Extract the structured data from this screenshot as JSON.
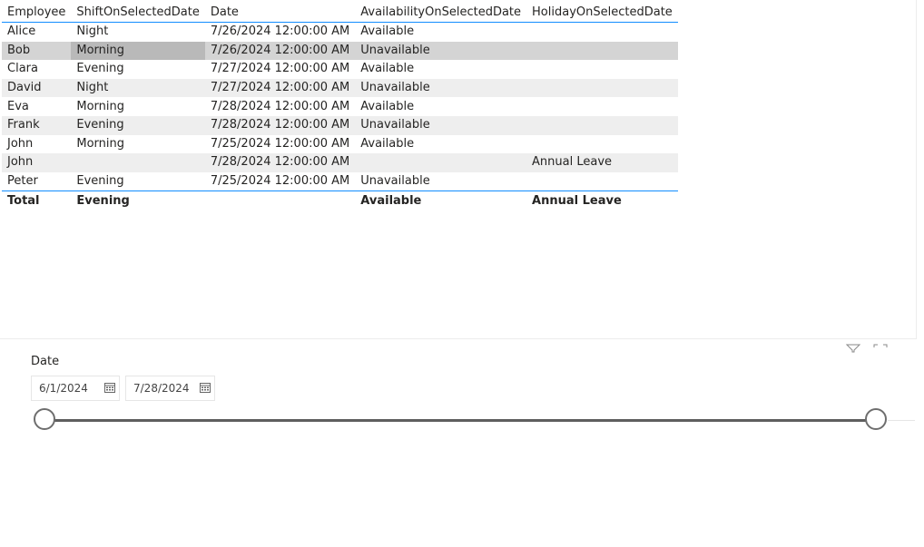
{
  "table": {
    "headers": [
      "Employee",
      "ShiftOnSelectedDate",
      "Date",
      "AvailabilityOnSelectedDate",
      "HolidayOnSelectedDate"
    ],
    "rows": [
      [
        "Alice",
        "Night",
        "7/26/2024 12:00:00 AM",
        "Available",
        ""
      ],
      [
        "Bob",
        "Morning",
        "7/26/2024 12:00:00 AM",
        "Unavailable",
        ""
      ],
      [
        "Clara",
        "Evening",
        "7/27/2024 12:00:00 AM",
        "Available",
        ""
      ],
      [
        "David",
        "Night",
        "7/27/2024 12:00:00 AM",
        "Unavailable",
        ""
      ],
      [
        "Eva",
        "Morning",
        "7/28/2024 12:00:00 AM",
        "Available",
        ""
      ],
      [
        "Frank",
        "Evening",
        "7/28/2024 12:00:00 AM",
        "Unavailable",
        ""
      ],
      [
        "John",
        "Morning",
        "7/25/2024 12:00:00 AM",
        "Available",
        ""
      ],
      [
        "John",
        "",
        "7/28/2024 12:00:00 AM",
        "",
        "Annual Leave"
      ],
      [
        "Peter",
        "Evening",
        "7/25/2024 12:00:00 AM",
        "Unavailable",
        ""
      ]
    ],
    "total": [
      "Total",
      "Evening",
      "",
      "Available",
      "Annual Leave"
    ]
  },
  "slicer": {
    "title": "Date",
    "start_date": "6/1/2024",
    "end_date": "7/28/2024",
    "range_start_fraction": 0,
    "range_end_fraction": 1
  },
  "icons": {
    "filter": "filter-icon",
    "focus": "focus-mode-icon",
    "calendar": "calendar-icon"
  },
  "colors": {
    "accent": "#118dff",
    "track": "#5e5e5e"
  }
}
